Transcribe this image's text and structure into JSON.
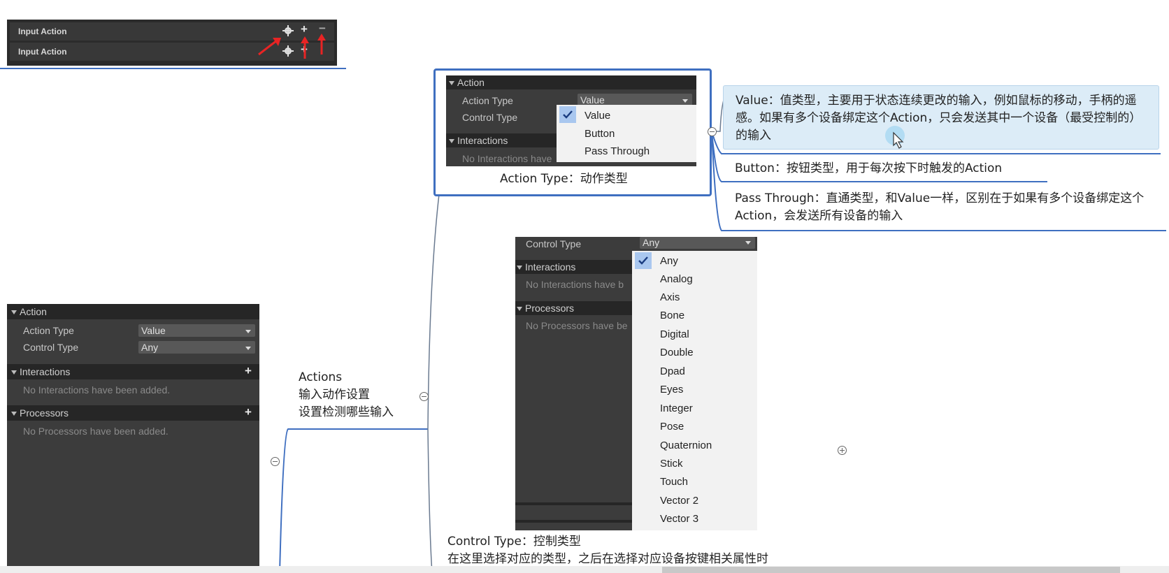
{
  "top_panel": {
    "rows": [
      {
        "label": "Input Action"
      },
      {
        "label": "Input Action"
      }
    ],
    "icons": [
      "gear-icon",
      "plus-icon",
      "minus-icon"
    ]
  },
  "left_panel": {
    "action_header": "Action",
    "action_type_label": "Action Type",
    "action_type_value": "Value",
    "control_type_label": "Control Type",
    "control_type_value": "Any",
    "interactions_header": "Interactions",
    "interactions_empty": "No Interactions have been added.",
    "processors_header": "Processors",
    "processors_empty": "No Processors have been added."
  },
  "actions_node": {
    "title": "Actions",
    "line1": "输入动作设置",
    "line2": "设置检测哪些输入"
  },
  "action_type_box": {
    "header": "Action",
    "action_type_label": "Action Type",
    "action_type_value": "Value",
    "control_type_label": "Control Type",
    "interactions_header": "Interactions",
    "interactions_empty": "No Interactions have",
    "menu": [
      "Value",
      "Button",
      "Pass Through"
    ],
    "selected": "Value",
    "caption": "Action Type：动作类型"
  },
  "notes": {
    "value": "Value：值类型，主要用于状态连续更改的输入，例如鼠标的移动，手柄的遥感。如果有多个设备绑定这个Action，只会发送其中一个设备（最受控制的）的输入",
    "button": "Button：按钮类型，用于每次按下时触发的Action",
    "pass_through": "Pass Through：直通类型，和Value一样，区别在于如果有多个设备绑定这个Action，会发送所有设备的输入"
  },
  "control_type_box": {
    "control_type_label": "Control Type",
    "control_type_value": "Any",
    "interactions_header": "Interactions",
    "interactions_empty": "No Interactions have b",
    "processors_header": "Processors",
    "processors_empty": "No Processors have be",
    "menu": [
      "Any",
      "Analog",
      "Axis",
      "Bone",
      "Digital",
      "Double",
      "Dpad",
      "Eyes",
      "Integer",
      "Pose",
      "Quaternion",
      "Stick",
      "Touch",
      "Vector 2",
      "Vector 3"
    ],
    "selected": "Any"
  },
  "control_type_note": {
    "line1": "Control Type：控制类型",
    "line2": "在这里选择对应的类型，之后在选择对应设备按键相关属性时"
  },
  "colors": {
    "accent_blue": "#3f6fc0",
    "highlight_bg": "#dcecf7",
    "arrow_red": "#e82424"
  }
}
